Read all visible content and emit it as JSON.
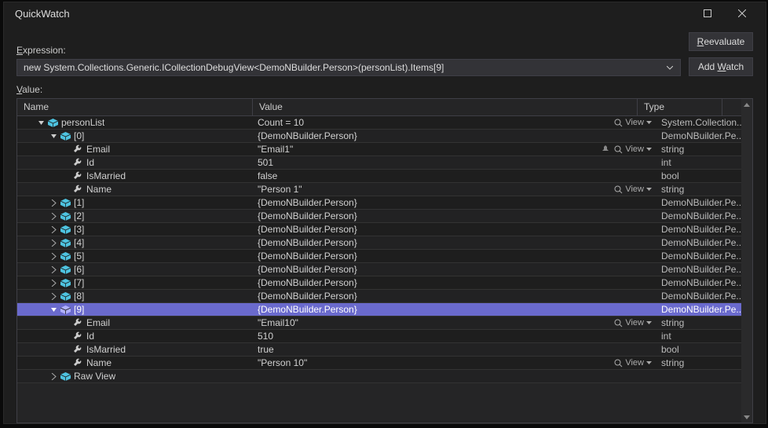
{
  "window": {
    "title": "QuickWatch"
  },
  "labels": {
    "expression_prefix": "E",
    "expression_rest": "xpression:",
    "value_prefix": "V",
    "value_rest": "alue:"
  },
  "expression": {
    "text": "new System.Collections.Generic.ICollectionDebugView<DemoNBuilder.Person>(personList).Items[9]"
  },
  "buttons": {
    "reevaluate_prefix": "R",
    "reevaluate_rest": "eevaluate",
    "addwatch_prefix": "Add ",
    "addwatch_ul": "W",
    "addwatch_rest": "atch"
  },
  "columns": {
    "name": "Name",
    "value": "Value",
    "type": "Type"
  },
  "view_label": "View",
  "rows": [
    {
      "depth": 1,
      "expander": "open",
      "icon": "obj",
      "name": "personList",
      "value": "Count = 10",
      "view": true,
      "type": "System.Collection..."
    },
    {
      "depth": 2,
      "expander": "open",
      "icon": "obj",
      "name": "[0]",
      "value": "{DemoNBuilder.Person}",
      "view": false,
      "type": "DemoNBuilder.Pe..."
    },
    {
      "depth": 3,
      "expander": "none",
      "icon": "wrench",
      "name": "Email",
      "value": "\"Email1\"",
      "pin": true,
      "view": true,
      "type": "string"
    },
    {
      "depth": 3,
      "expander": "none",
      "icon": "wrench",
      "name": "Id",
      "value": "501",
      "view": false,
      "type": "int"
    },
    {
      "depth": 3,
      "expander": "none",
      "icon": "wrench",
      "name": "IsMarried",
      "value": "false",
      "view": false,
      "type": "bool"
    },
    {
      "depth": 3,
      "expander": "none",
      "icon": "wrench",
      "name": "Name",
      "value": "\"Person 1\"",
      "view": true,
      "type": "string"
    },
    {
      "depth": 2,
      "expander": "closed",
      "icon": "obj",
      "name": "[1]",
      "value": "{DemoNBuilder.Person}",
      "view": false,
      "type": "DemoNBuilder.Pe..."
    },
    {
      "depth": 2,
      "expander": "closed",
      "icon": "obj",
      "name": "[2]",
      "value": "{DemoNBuilder.Person}",
      "view": false,
      "type": "DemoNBuilder.Pe..."
    },
    {
      "depth": 2,
      "expander": "closed",
      "icon": "obj",
      "name": "[3]",
      "value": "{DemoNBuilder.Person}",
      "view": false,
      "type": "DemoNBuilder.Pe..."
    },
    {
      "depth": 2,
      "expander": "closed",
      "icon": "obj",
      "name": "[4]",
      "value": "{DemoNBuilder.Person}",
      "view": false,
      "type": "DemoNBuilder.Pe..."
    },
    {
      "depth": 2,
      "expander": "closed",
      "icon": "obj",
      "name": "[5]",
      "value": "{DemoNBuilder.Person}",
      "view": false,
      "type": "DemoNBuilder.Pe..."
    },
    {
      "depth": 2,
      "expander": "closed",
      "icon": "obj",
      "name": "[6]",
      "value": "{DemoNBuilder.Person}",
      "view": false,
      "type": "DemoNBuilder.Pe..."
    },
    {
      "depth": 2,
      "expander": "closed",
      "icon": "obj",
      "name": "[7]",
      "value": "{DemoNBuilder.Person}",
      "view": false,
      "type": "DemoNBuilder.Pe..."
    },
    {
      "depth": 2,
      "expander": "closed",
      "icon": "obj",
      "name": "[8]",
      "value": "{DemoNBuilder.Person}",
      "view": false,
      "type": "DemoNBuilder.Pe..."
    },
    {
      "depth": 2,
      "expander": "open",
      "icon": "obj",
      "name": "[9]",
      "value": "{DemoNBuilder.Person}",
      "view": false,
      "type": "DemoNBuilder.Pe...",
      "selected": true
    },
    {
      "depth": 3,
      "expander": "none",
      "icon": "wrench",
      "name": "Email",
      "value": "\"Email10\"",
      "view": true,
      "type": "string"
    },
    {
      "depth": 3,
      "expander": "none",
      "icon": "wrench",
      "name": "Id",
      "value": "510",
      "view": false,
      "type": "int"
    },
    {
      "depth": 3,
      "expander": "none",
      "icon": "wrench",
      "name": "IsMarried",
      "value": "true",
      "view": false,
      "type": "bool"
    },
    {
      "depth": 3,
      "expander": "none",
      "icon": "wrench",
      "name": "Name",
      "value": "\"Person 10\"",
      "view": true,
      "type": "string"
    },
    {
      "depth": 2,
      "expander": "closed",
      "icon": "obj",
      "name": "Raw View",
      "value": "",
      "view": false,
      "type": ""
    }
  ],
  "layout": {
    "col_name_w": 300,
    "col_value_w": 490,
    "col_type_w": 108
  }
}
